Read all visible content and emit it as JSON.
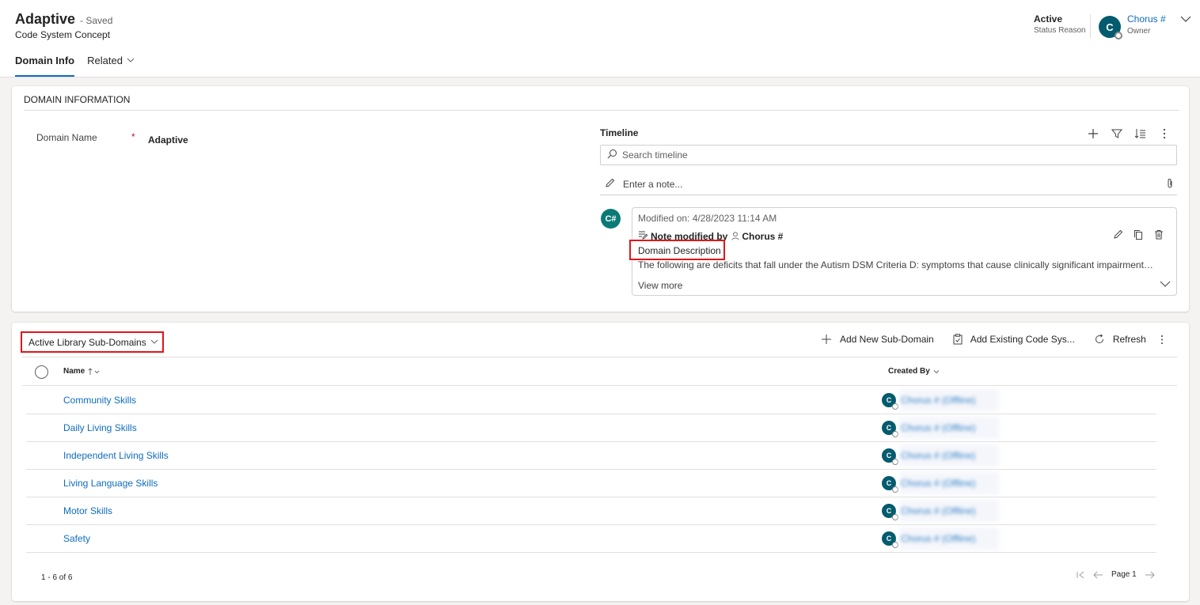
{
  "header": {
    "title": "Adaptive",
    "saved_status": "- Saved",
    "entity": "Code System Concept",
    "tabs": [
      {
        "label": "Domain Info"
      },
      {
        "label": "Related"
      }
    ],
    "status_value": "Active",
    "status_label": "Status Reason",
    "owner_initial": "C",
    "owner_name": "Chorus #",
    "owner_label": "Owner"
  },
  "domain_section": {
    "title": "DOMAIN INFORMATION",
    "field_label": "Domain Name",
    "required_mark": "*",
    "field_value": "Adaptive"
  },
  "timeline": {
    "title": "Timeline",
    "search_placeholder": "Search timeline",
    "note_placeholder": "Enter a note...",
    "entry": {
      "avatar": "C#",
      "modified": "Modified on: 4/28/2023 11:14 AM",
      "action": "Note modified by",
      "user": "Chorus #",
      "title": "Domain Description",
      "body": "The following are deficits that fall under the Autism DSM Criteria D: symptoms that cause clinically significant impairment in s...",
      "view_more": "View more"
    }
  },
  "subgrid": {
    "view_label": "Active Library Sub-Domains",
    "commands": {
      "add_new": "Add New Sub-Domain",
      "add_existing": "Add Existing Code Sys...",
      "refresh": "Refresh"
    },
    "columns": {
      "name": "Name",
      "created_by": "Created By"
    },
    "rows": [
      {
        "name": "Community Skills",
        "created_by": "Chorus # (Offline)",
        "initial": "C"
      },
      {
        "name": "Daily Living Skills",
        "created_by": "Chorus # (Offline)",
        "initial": "C"
      },
      {
        "name": "Independent Living Skills",
        "created_by": "Chorus # (Offline)",
        "initial": "C"
      },
      {
        "name": "Living Language Skills",
        "created_by": "Chorus # (Offline)",
        "initial": "C"
      },
      {
        "name": "Motor Skills",
        "created_by": "Chorus # (Offline)",
        "initial": "C"
      },
      {
        "name": "Safety",
        "created_by": "Chorus # (Offline)",
        "initial": "C"
      }
    ],
    "record_count": "1 - 6 of 6",
    "page_label": "Page 1"
  },
  "colors": {
    "accent": "#0f6cbd",
    "avatar": "#035b6e",
    "highlight_box": "#e0161b"
  }
}
